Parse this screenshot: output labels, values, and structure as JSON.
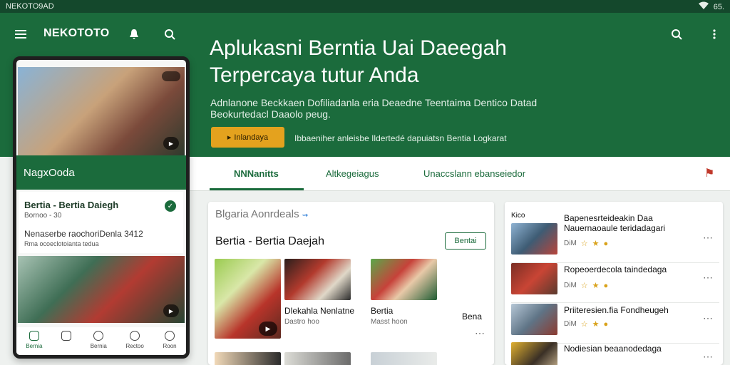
{
  "statusbar": {
    "app_name": "NEKOTO9AD",
    "battery": "65."
  },
  "topbar": {
    "brand": "NEKOTOTO"
  },
  "hero": {
    "title": "Aplukasni Berntia Uai Daeegah Terpercaya tutur Anda",
    "description": "Adnlanone Beckkaen Dofiliadanla eria Deaedne Teentaima Dentico Datad Beokurtedacl Daaolo peug.",
    "cta_label": "Inlandaya",
    "cta_note": "Ibbaeniher anleisbe Ildertedé dapuiatsn Bentia Logkarat"
  },
  "phone": {
    "band_label": "NagxOoda",
    "card_title": "Bertia - Bertia Daiegh",
    "card_sub": "Bornoo - 30",
    "card_line": "Nenaserbe raochoriDenla 3412",
    "card_meta": "Rma  ocoeclotoianta tedua",
    "nav": [
      "Bernia",
      "",
      "Bernia",
      "Rectoo",
      "Roon"
    ]
  },
  "tabs": [
    "NNNanitts",
    "Altkegeiagus",
    "Unaccslann ebanseiedor"
  ],
  "middle": {
    "section_label": "Blgaria Aonrdeals",
    "heading": "Bertia - Bertia Daejah",
    "more_label": "Bentai",
    "items": [
      {
        "name": "",
        "meta": "",
        "duration": ""
      },
      {
        "name": "Dlekahla Nenlatne",
        "meta": "Dastro hoo",
        "duration": ""
      },
      {
        "name": "Bertia",
        "meta": "Masst hoon",
        "duration": ""
      },
      {
        "name": "Bena",
        "meta": "",
        "duration": ""
      }
    ]
  },
  "right_list": {
    "head": "Kico",
    "items": [
      {
        "title": "Bapenesrteideakin Daa Nauernaoaule teridadagari",
        "meta": "DiM"
      },
      {
        "title": "Ropeoerdecola taindedaga",
        "meta": "DiM"
      },
      {
        "title": "Priiteresien.fia Fondheugeh",
        "meta": "DiM"
      },
      {
        "title": "Nodiesian beaanodedaga",
        "meta": ""
      }
    ]
  },
  "colors": {
    "primary": "#1b6b3c",
    "accent": "#e4a21e",
    "alert": "#c0392b"
  }
}
